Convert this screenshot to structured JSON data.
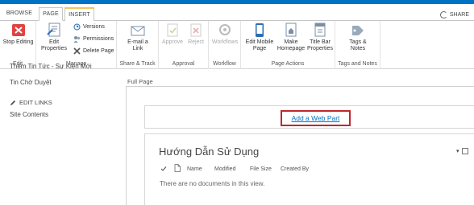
{
  "ribbon_tabs": {
    "browse": "BROWSE",
    "page": "PAGE",
    "insert": "INSERT"
  },
  "share_label": "SHARE",
  "groups": {
    "edit": {
      "title": "Edit",
      "stop_editing": "Stop Editing"
    },
    "manage": {
      "title": "Manage",
      "edit_properties_line1": "Edit",
      "edit_properties_line2": "Properties",
      "versions": "Versions",
      "permissions": "Permissions",
      "delete_page": "Delete Page"
    },
    "share_track": {
      "title": "Share & Track",
      "email_line1": "E-mail a",
      "email_line2": "Link"
    },
    "approval": {
      "title": "Approval",
      "approve": "Approve",
      "reject": "Reject"
    },
    "workflow": {
      "title": "Workflow",
      "workflows": "Workflows"
    },
    "page_actions": {
      "title": "Page Actions",
      "edit_mobile_line1": "Edit Mobile",
      "edit_mobile_line2": "Page",
      "make_homepage_line1": "Make",
      "make_homepage_line2": "Homepage",
      "title_bar_line1": "Title Bar",
      "title_bar_line2": "Properties"
    },
    "tags_notes": {
      "title": "Tags and Notes",
      "tags_line1": "Tags &",
      "tags_line2": "Notes"
    }
  },
  "leftnav": {
    "item_cut": "Thêm Tin Tức - Sự Kiện Mới",
    "item_pending": "Tin Chờ Duyệt",
    "edit_links": "EDIT LINKS",
    "site_contents": "Site Contents"
  },
  "main": {
    "layout_label": "Full Page",
    "add_web_part": "Add a Web Part",
    "webpart_title": "Hướng Dẫn Sử Dụng",
    "columns": [
      "Name",
      "Modified",
      "File Size",
      "Created By"
    ],
    "empty_message": "There are no documents in this view."
  },
  "colors": {
    "accent_blue": "#0072c6",
    "highlight_red": "#c0272d",
    "stop_red": "#e04343",
    "tab_gold": "#f0c85a"
  }
}
